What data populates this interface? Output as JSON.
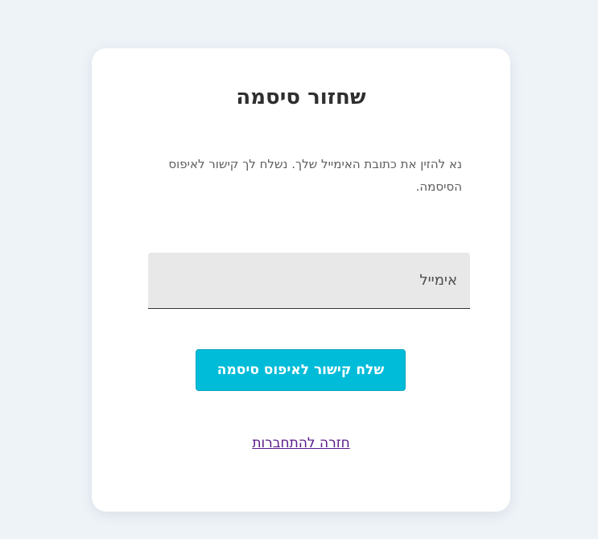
{
  "card": {
    "title": "שחזור סיסמה",
    "description": "נא להזין את כתובת האימייל שלך. נשלח לך קישור לאיפוס הסיסמה.",
    "email": {
      "placeholder": "אימייל",
      "value": ""
    },
    "submit_label": "שלח קישור לאיפוס סיסמה",
    "back_link_label": "חזרה להתחברות"
  },
  "colors": {
    "page_background": "#eef3f8",
    "card_background": "#ffffff",
    "button_background": "#00bcd8",
    "link": "#5a1a8a"
  }
}
